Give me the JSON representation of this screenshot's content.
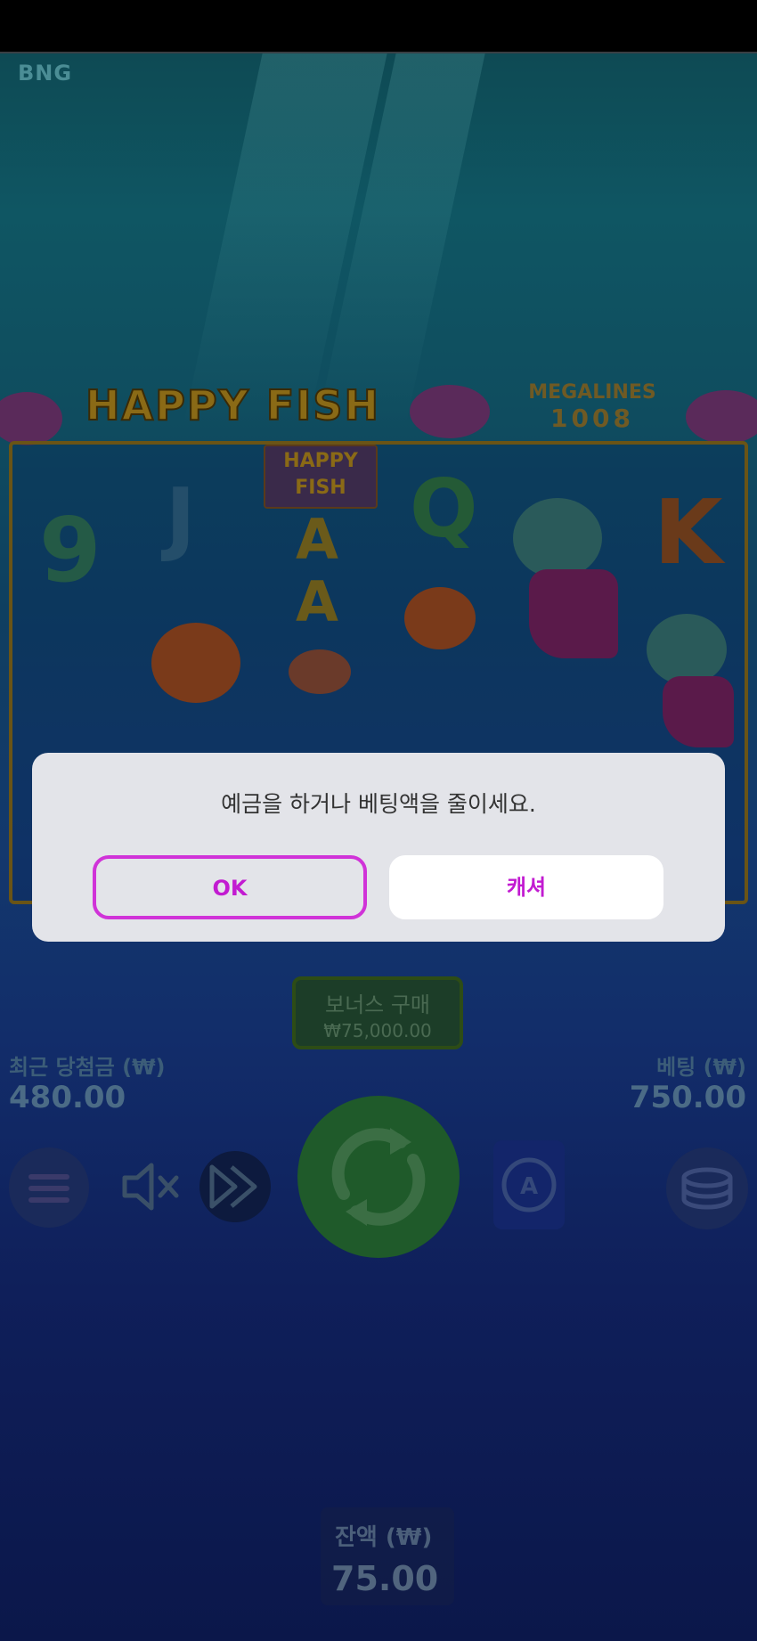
{
  "game": {
    "brand": "BNG",
    "title": "HAPPY FISH",
    "megalines_label": "MEGALINES",
    "megalines_value": "1008",
    "reel_symbols": [
      "9",
      "J",
      "A",
      "A",
      "Q",
      "K"
    ],
    "reel_badge": "HAPPY FISH"
  },
  "stats": {
    "last_win_label": "최근 당첨금 (₩)",
    "last_win_value": "480.00",
    "bet_label": "베팅 (₩)",
    "bet_value": "750.00",
    "balance_label": "잔액 (₩)",
    "balance_value": "75.00"
  },
  "bonus": {
    "label": "보너스 구매",
    "price": "₩75,000.00"
  },
  "controls": {
    "menu_icon": "menu-icon",
    "mute_icon": "mute-icon",
    "turbo_icon": "fast-forward-icon",
    "spin_icon": "spin-icon",
    "autoplay_icon": "autoplay-icon",
    "coins_icon": "coins-icon"
  },
  "dialog": {
    "message": "예금을 하거나 베팅액을 줄이세요.",
    "ok_label": "OK",
    "cashier_label": "캐셔"
  },
  "colors": {
    "accent": "#c21bd1",
    "dialog_bg": "#e3e4e9"
  }
}
